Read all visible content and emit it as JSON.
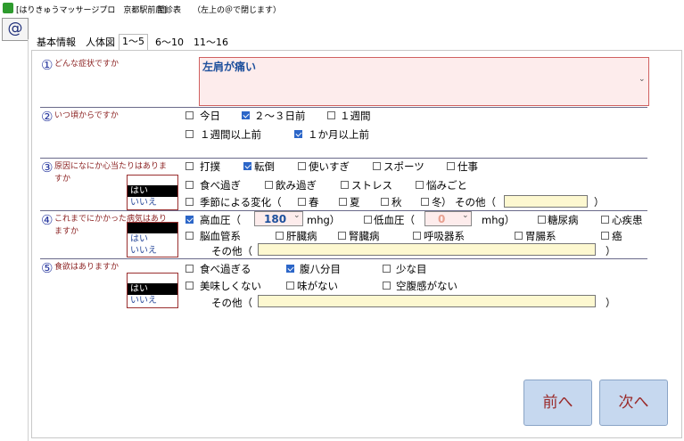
{
  "titlebar": {
    "app_name": "[はりきゅうマッサージプロ　京都駅前店]",
    "screen": "問診表",
    "hint": "（左上の＠で閉じます）"
  },
  "at_label": "@",
  "tabs": [
    "基本情報",
    "人体図",
    "1～5",
    "6～10",
    "11～16"
  ],
  "active_tab": 2,
  "yes_label": "はい",
  "no_label": "いいえ",
  "q1": {
    "num": "①",
    "label": "どんな症状ですか",
    "value": "左肩が痛い"
  },
  "q2": {
    "num": "②",
    "label": "いつ頃からですか",
    "options": [
      {
        "label": "今日",
        "checked": false
      },
      {
        "label": "２～３日前",
        "checked": true
      },
      {
        "label": "１週間",
        "checked": false
      },
      {
        "label": "１週間以上前",
        "checked": false
      },
      {
        "label": "１か月以上前",
        "checked": true
      }
    ]
  },
  "q3": {
    "num": "③",
    "label_l1": "原因になにか心当たりはありま",
    "label_l2": "すか",
    "options": [
      {
        "label": "打撲",
        "checked": false
      },
      {
        "label": "転倒",
        "checked": true
      },
      {
        "label": "使いすぎ",
        "checked": false
      },
      {
        "label": "スポーツ",
        "checked": false
      },
      {
        "label": "仕事",
        "checked": false
      },
      {
        "label": "食べ過ぎ",
        "checked": false
      },
      {
        "label": "飲み過ぎ",
        "checked": false
      },
      {
        "label": "ストレス",
        "checked": false
      },
      {
        "label": "悩みごと",
        "checked": false
      }
    ],
    "seasonal_label": "季節による変化（",
    "seasons": [
      {
        "label": "春",
        "checked": false
      },
      {
        "label": "夏",
        "checked": false
      },
      {
        "label": "秋",
        "checked": false
      },
      {
        "label": "冬",
        "checked": false
      }
    ],
    "season_close": "）",
    "other_label": "その他（",
    "other_close": "）"
  },
  "q4": {
    "num": "④",
    "label_l1": "これまでにかかった病気はあり",
    "label_l2": "ますか",
    "hbp_label": "高血圧（",
    "hbp_checked": true,
    "hbp_value": "180",
    "lbp_label": "低血圧（",
    "lbp_checked": false,
    "lbp_value": "0",
    "unit": "mhg）",
    "options": [
      {
        "label": "糖尿病",
        "checked": false
      },
      {
        "label": "心疾患",
        "checked": false
      },
      {
        "label": "脳血管系",
        "checked": false
      },
      {
        "label": "肝臓病",
        "checked": false
      },
      {
        "label": "腎臓病",
        "checked": false
      },
      {
        "label": "呼吸器系",
        "checked": false
      },
      {
        "label": "胃腸系",
        "checked": false
      },
      {
        "label": "癌",
        "checked": false
      }
    ],
    "other_label": "その他（",
    "other_close": "）"
  },
  "q5": {
    "num": "⑤",
    "label": "食欲はありますか",
    "options": [
      {
        "label": "食べ過ぎる",
        "checked": false
      },
      {
        "label": "腹八分目",
        "checked": true
      },
      {
        "label": "少な目",
        "checked": false
      },
      {
        "label": "美味しくない",
        "checked": false
      },
      {
        "label": "味がない",
        "checked": false
      },
      {
        "label": "空腹感がない",
        "checked": false
      }
    ],
    "other_label": "その他（",
    "other_close": "）"
  },
  "nav": {
    "prev": "前へ",
    "next": "次へ"
  },
  "colors": {
    "accent_text": "#1d4f9c",
    "label_red": "#8a1f1f",
    "check_blue": "#2c66c8",
    "input_pink": "#fdecec",
    "input_yellow": "#fdf8d0",
    "button_blue": "#c6d8ef"
  }
}
